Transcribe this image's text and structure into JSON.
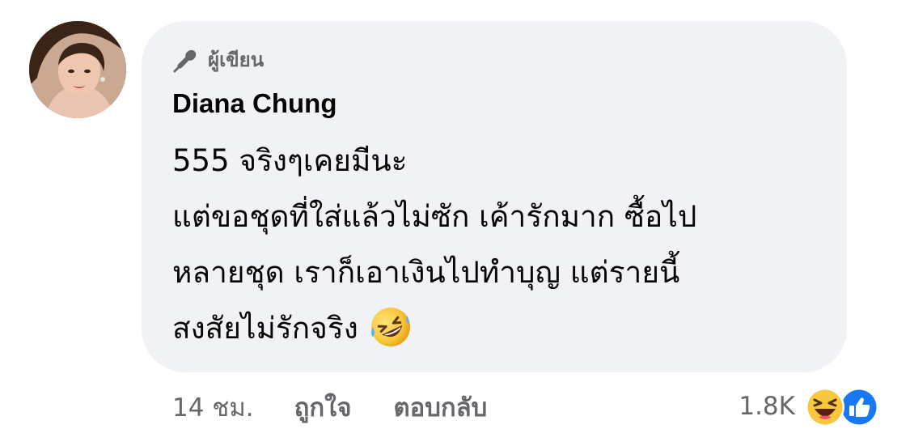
{
  "comment": {
    "author_badge": "ผู้เขียน",
    "author_name": "Diana Chung",
    "lines": [
      "555 จริงๆเคยมีนะ",
      "แต่ขอชุดที่ใส่แล้วไม่ซัก  เค้ารักมาก ซื้อไป",
      "หลายชุด เราก็เอาเงินไปทำบุญ แต่รายนี้",
      "สงสัยไม่รักจริง"
    ],
    "inline_emoji": "rofl-emoji"
  },
  "actions": {
    "time": "14 ชม.",
    "like_label": "ถูกใจ",
    "reply_label": "ตอบกลับ"
  },
  "reactions": {
    "count": "1.8K",
    "icons": [
      "haha-reaction-icon",
      "like-reaction-icon"
    ]
  },
  "colors": {
    "bubble_bg": "#f0f2f5",
    "secondary_text": "#65676b",
    "primary_text": "#050505",
    "like_blue": "#1877f2",
    "haha_yellow": "#f7c83d"
  }
}
